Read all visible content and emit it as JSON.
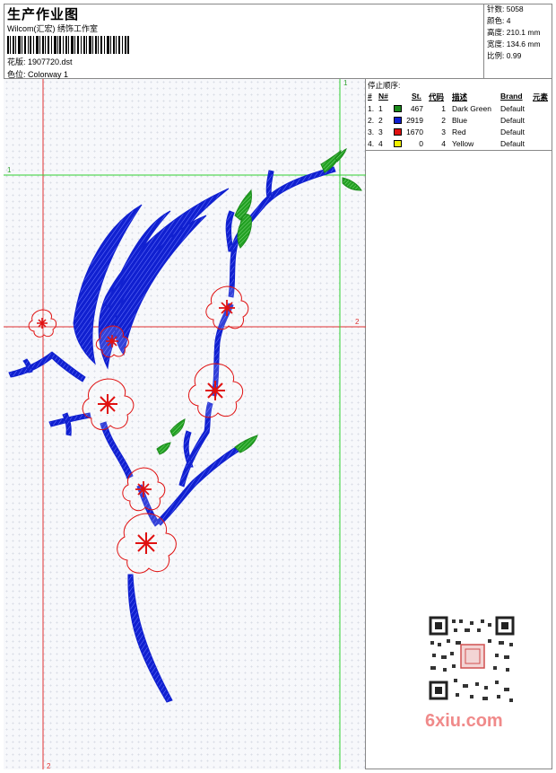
{
  "header": {
    "title": "生产作业图",
    "subtitle": "Wilcom(汇宏) 绣饰工作室",
    "design": "花版: 1907720.dst",
    "colorway": "色位: Colorway 1"
  },
  "stats": [
    {
      "label": "针数",
      "value": "5058"
    },
    {
      "label": "颜色",
      "value": "4"
    },
    {
      "label": "高度",
      "value": "210.1 mm"
    },
    {
      "label": "宽度",
      "value": "134.6 mm"
    },
    {
      "label": "比例",
      "value": "0.99"
    }
  ],
  "stop_panel": {
    "title": "停止顺序:",
    "headers": {
      "num": "#",
      "n": "N#",
      "st": "St.",
      "code": "代码",
      "desc": "描述",
      "brand": "Brand",
      "elem": "元素"
    },
    "rows": [
      {
        "num": "1.",
        "n": "1",
        "color": "#1a8a1a",
        "st": "467",
        "code": "1",
        "desc": "Dark Green",
        "brand": "Default"
      },
      {
        "num": "2.",
        "n": "2",
        "color": "#1020d0",
        "st": "2919",
        "code": "2",
        "desc": "Blue",
        "brand": "Default"
      },
      {
        "num": "3.",
        "n": "3",
        "color": "#e01010",
        "st": "1670",
        "code": "3",
        "desc": "Red",
        "brand": "Default"
      },
      {
        "num": "4.",
        "n": "4",
        "color": "#f0f000",
        "st": "0",
        "code": "4",
        "desc": "Yellow",
        "brand": "Default"
      }
    ]
  },
  "guides": {
    "v1": "1",
    "v2": "2",
    "h1": "1",
    "h2": "2"
  },
  "watermark": "6xiu.com",
  "colors": {
    "green": "#22a022",
    "blue": "#1020d0",
    "red": "#e01010",
    "guide_red": "#e03030",
    "guide_green": "#30d030"
  }
}
